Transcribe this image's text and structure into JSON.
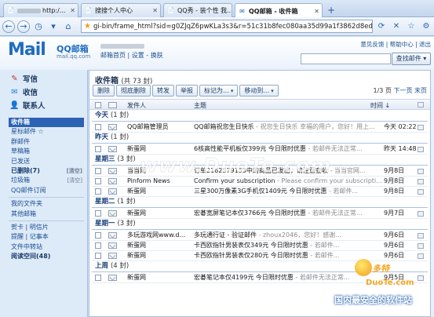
{
  "browser": {
    "tabs": [
      {
        "label": "http:/...",
        "active": false
      },
      {
        "label": "搜搜个人中心",
        "active": false
      },
      {
        "label": "QQ秀 - 装个性 我...",
        "active": false
      },
      {
        "label": "QQ邮箱 - 收件箱",
        "active": true
      }
    ],
    "new_tab_symbol": "+",
    "address": "gi-bin/frame_html?sid=g0ZJqZ6pwKLa3s3&r=51c31b8fec080aa35d99a1f3862d8ed3"
  },
  "mail_header": {
    "logo_main": "Mail",
    "logo_qq": "QQ邮箱",
    "logo_domain": "mail.qq.com",
    "nav": [
      "邮箱首页",
      "设置",
      "换肤"
    ],
    "top_links": [
      "意见反馈",
      "帮助中心",
      "退出"
    ],
    "search_button": "查找邮件 ▾"
  },
  "sidebar": {
    "quick": [
      {
        "label": "写信",
        "icon": "pen-icon"
      },
      {
        "label": "收信",
        "icon": "inbox-icon"
      },
      {
        "label": "联系人",
        "icon": "contacts-icon"
      }
    ],
    "folders": [
      {
        "label": "收件箱",
        "extra": ""
      },
      {
        "label": "星标邮件 ☆",
        "extra": ""
      },
      {
        "label": "群邮件",
        "extra": ""
      },
      {
        "label": "草稿箱",
        "extra": ""
      },
      {
        "label": "已发送",
        "extra": ""
      },
      {
        "label": "已删除(7)",
        "extra": "[清空]"
      },
      {
        "label": "垃圾箱",
        "extra": "[清空]"
      },
      {
        "label": "QQ邮件订阅",
        "extra": ""
      }
    ],
    "folders_bottom": [
      {
        "label": "我的文件夹"
      },
      {
        "label": "其他邮箱"
      }
    ],
    "tools": [
      {
        "label": "贺卡 | 明信片"
      },
      {
        "label": "提醒 | 记事本"
      },
      {
        "label": "文件中转站"
      },
      {
        "label": "阅读空间(48)"
      }
    ]
  },
  "main": {
    "title": "收件箱",
    "count": "(共 73 封)",
    "toolbar": {
      "delete": "删除",
      "perm_delete": "彻底删除",
      "forward": "转发",
      "report": "举报",
      "mark_as": "标记为...",
      "move_to": "移动到..."
    },
    "pager": {
      "page": "1/3 页",
      "next": "下一页",
      "last": "末页"
    },
    "columns": {
      "sender": "发件人",
      "subject": "主题",
      "time": "时间 ↓"
    },
    "groups": [
      {
        "label": "今天",
        "count": "(1 封)",
        "rows": [
          {
            "from": "QQ邮箱管理员",
            "subject": "QQ邮箱祝您生日快乐",
            "preview": " - 祝您生日快乐 幸福的用户，您好！用上...",
            "time": "今天 02:22"
          }
        ]
      },
      {
        "label": "昨天",
        "count": "(1 封)",
        "rows": [
          {
            "from": "新蛋网",
            "subject": "6核高性能平机板仅399元 今日限时优惠",
            "preview": " - 若邮件无法正常...",
            "time": "昨天 14:48"
          }
        ]
      },
      {
        "label": "星期三",
        "count": "(3 封)",
        "rows": [
          {
            "from": "当当网",
            "subject": "订单2162579153中的商品已发出，请注意查收",
            "preview": " - 当当官网...",
            "time": "9月8日"
          },
          {
            "from": "Pinform News",
            "subject": "Confirm your subscription",
            "preview": " - Please confirm your subscripti...",
            "time": "9月8日"
          },
          {
            "from": "新蛋网",
            "subject": "三星300万像素3G手机仅1409元 今日限时优惠",
            "preview": " - 若邮件...",
            "time": "9月8日"
          }
        ]
      },
      {
        "label": "星期二",
        "count": "(1 封)",
        "rows": [
          {
            "from": "新蛋网",
            "subject": "宏碁宽屏笔记本仅3766元 今日限时优惠",
            "preview": " - 若邮件无法正常...",
            "time": "9月7日"
          }
        ]
      },
      {
        "label": "星期一",
        "count": "(3 封)",
        "rows": [
          {
            "from": "多玩游戏网www.d...",
            "subject": "多玩通行证 - 验证邮件",
            "preview": " - zhoux2046，您好！感谢...",
            "time": "9月6日"
          },
          {
            "from": "新蛋网",
            "subject": "卡西欧指针男装表仅349元 今日限时优惠",
            "preview": " - 若邮件...",
            "time": "9月6日"
          },
          {
            "from": "新蛋网",
            "subject": "卡西欧指针男装表仅280元 今日限时优惠",
            "preview": " - 若邮件...",
            "time": "9月6日"
          }
        ]
      },
      {
        "label": "上周",
        "count": "(4 封)",
        "rows": [
          {
            "from": "新蛋网",
            "subject": "宏碁笔记本仅4199元 今日限时优惠",
            "preview": " - 若邮件无法正常...",
            "time": "9月5日"
          }
        ]
      }
    ]
  },
  "watermarks": {
    "center": "www.DuoTe.com",
    "corner_top": "多特",
    "corner_site": "DuoTe.com",
    "corner_tag": "国内最安全的软件站"
  },
  "colors": {
    "accent": "#2c62b3",
    "group_text": "#1a3f78",
    "sidebar_bg": "#ddeaf8"
  }
}
